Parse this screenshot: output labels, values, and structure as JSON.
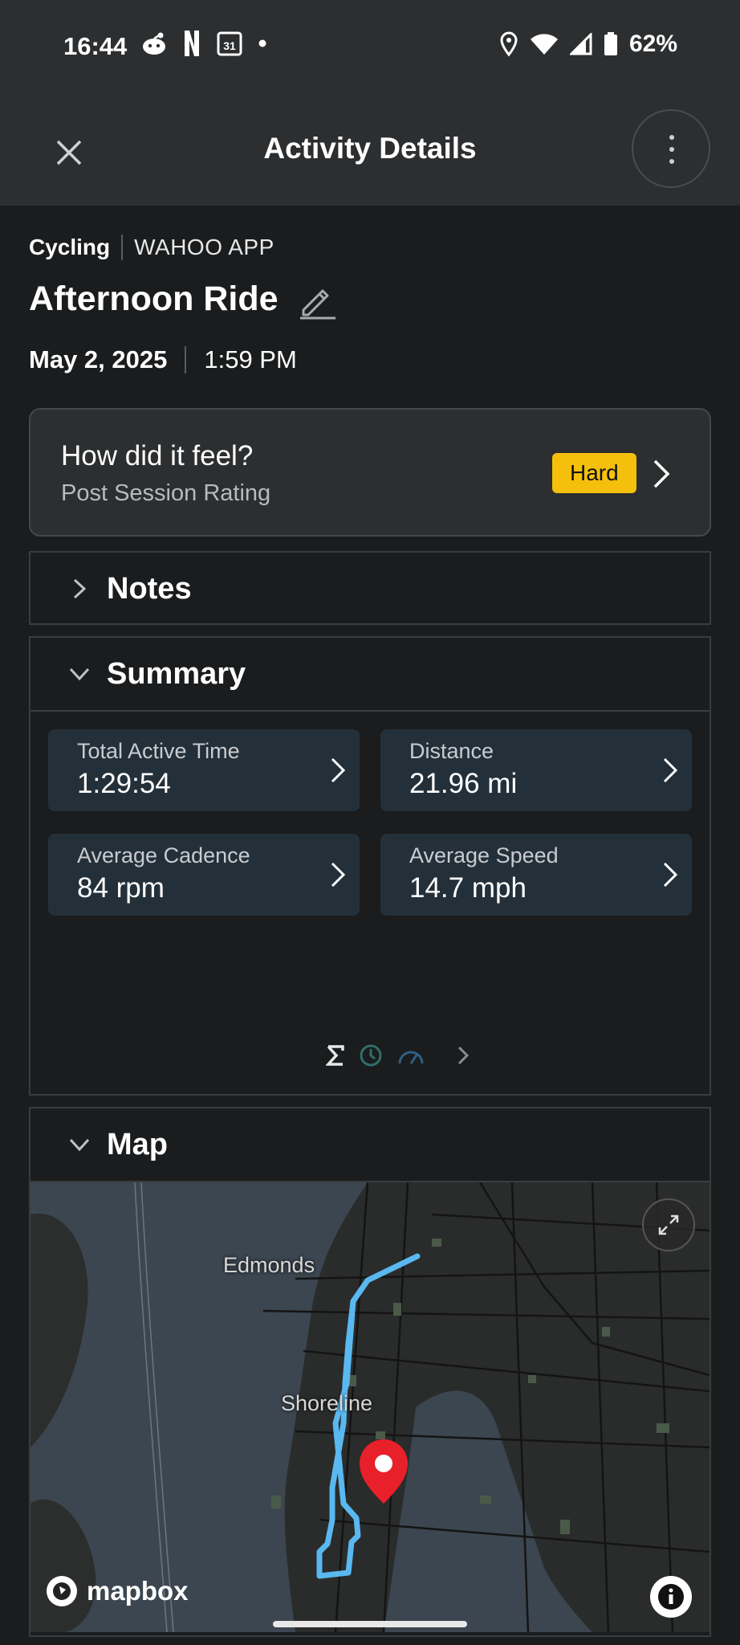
{
  "status_bar": {
    "time": "16:44",
    "notification_icons": [
      "reddit-icon",
      "netflix-icon",
      "calendar-icon",
      "dot-icon"
    ],
    "calendar_day": "31",
    "battery": "62%"
  },
  "app_bar": {
    "title": "Activity Details"
  },
  "activity": {
    "sport": "Cycling",
    "source": "WAHOO APP",
    "title": "Afternoon Ride",
    "date": "May 2, 2025",
    "time": "1:59 PM"
  },
  "feel_card": {
    "question": "How did it feel?",
    "subtitle": "Post Session Rating",
    "rating": "Hard",
    "rating_color": "#f5c00c"
  },
  "notes": {
    "title": "Notes"
  },
  "summary": {
    "title": "Summary",
    "tiles": [
      {
        "label": "Total Active Time",
        "value": "1:29:54"
      },
      {
        "label": "Distance",
        "value": "21.96 mi"
      },
      {
        "label": "Average Cadence",
        "value": "84 rpm"
      },
      {
        "label": "Average Speed",
        "value": "14.7 mph"
      }
    ],
    "pager_icons": [
      "sigma-icon",
      "clock-icon",
      "speedometer-icon",
      "chevron-right-icon"
    ]
  },
  "map": {
    "title": "Map",
    "places": [
      "Edmonds",
      "Shoreline"
    ],
    "attribution": "mapbox",
    "route_color": "#5ab8f0",
    "marker_color": "#e8202a"
  }
}
